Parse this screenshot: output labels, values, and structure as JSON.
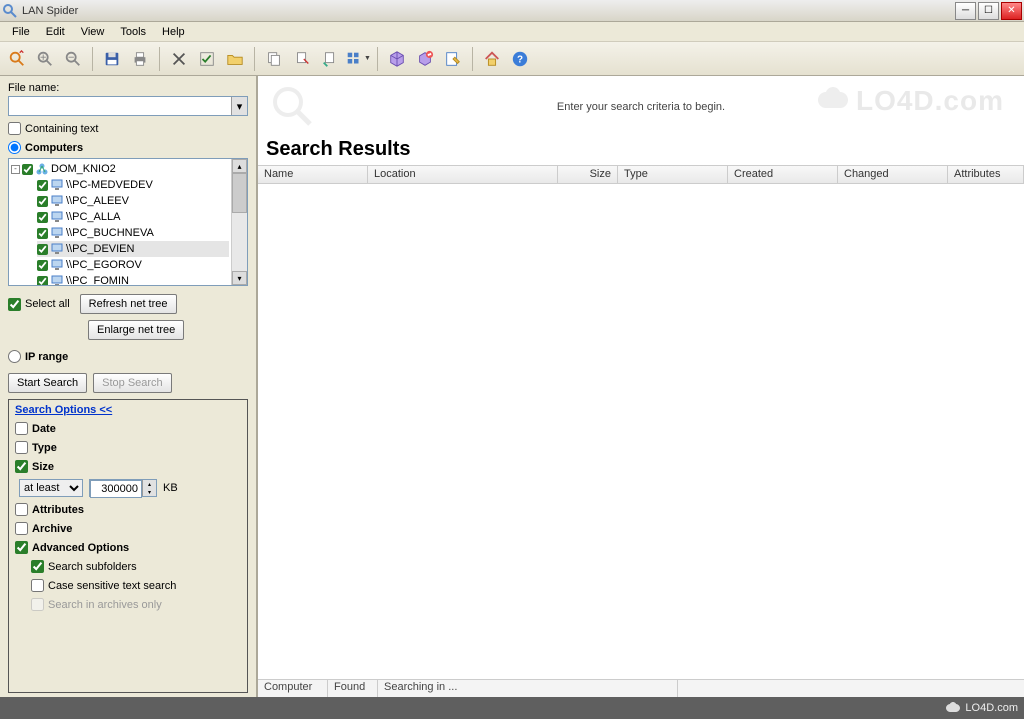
{
  "window": {
    "title": "LAN Spider"
  },
  "menus": [
    "File",
    "Edit",
    "View",
    "Tools",
    "Help"
  ],
  "sidebar": {
    "file_name_label": "File name:",
    "file_name_value": "",
    "containing_text_label": "Containing text",
    "computers_label": "Computers",
    "tree": {
      "root": "DOM_KNIO2",
      "items": [
        "\\\\PC-MEDVEDEV",
        "\\\\PC_ALEEV",
        "\\\\PC_ALLA",
        "\\\\PC_BUCHNEVA",
        "\\\\PC_DEVIEN",
        "\\\\PC_EGOROV",
        "\\\\PC_FOMIN"
      ],
      "selected_index": 4
    },
    "select_all_label": "Select all",
    "refresh_btn": "Refresh net tree",
    "enlarge_btn": "Enlarge net tree",
    "ip_range_label": "IP range",
    "start_search_btn": "Start Search",
    "stop_search_btn": "Stop Search",
    "options": {
      "title": "Search Options <<",
      "date_label": "Date",
      "type_label": "Type",
      "size_label": "Size",
      "size_op": "at least",
      "size_value": "300000",
      "size_unit": "KB",
      "attributes_label": "Attributes",
      "archive_label": "Archive",
      "advanced_label": "Advanced Options",
      "search_subfolders_label": "Search subfolders",
      "case_sensitive_label": "Case sensitive text search",
      "search_archives_label": "Search in archives only"
    }
  },
  "content": {
    "hint": "Enter your search criteria to begin.",
    "watermark": "LO4D.com",
    "results_heading": "Search Results",
    "columns": [
      "Name",
      "Location",
      "Size",
      "Type",
      "Created",
      "Changed",
      "Attributes"
    ],
    "status": {
      "computer": "Computer",
      "found": "Found",
      "searching": "Searching in ..."
    }
  },
  "footer": {
    "brand": "LO4D.com"
  }
}
